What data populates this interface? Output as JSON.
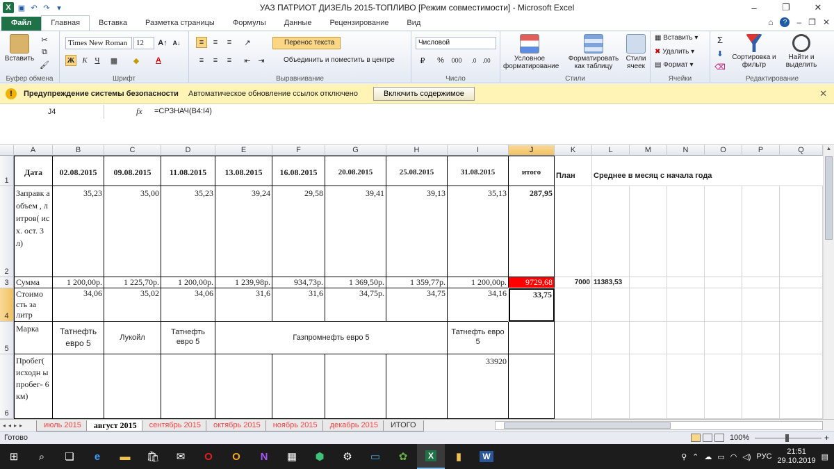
{
  "window": {
    "title": "УАЗ ПАТРИОТ ДИЗЕЛЬ 2015-ТОПЛИВО  [Режим совместимости]  -  Microsoft Excel"
  },
  "ribbon_tabs": [
    "Файл",
    "Главная",
    "Вставка",
    "Разметка страницы",
    "Формулы",
    "Данные",
    "Рецензирование",
    "Вид"
  ],
  "ribbon": {
    "paste": "Вставить",
    "clipboard_group": "Буфер обмена",
    "font_name": "Times New Roman",
    "font_size": "12",
    "font_group": "Шрифт",
    "wrap_text": "Перенос текста",
    "merge_center": "Объединить и поместить в центре",
    "align_group": "Выравнивание",
    "number_format": "Числовой",
    "number_group": "Число",
    "cond_format": "Условное форматирование",
    "format_table": "Форматировать как таблицу",
    "cell_styles": "Стили ячеек",
    "styles_group": "Стили",
    "insert": "Вставить",
    "delete": "Удалить",
    "format": "Формат",
    "cells_group": "Ячейки",
    "sort_filter": "Сортировка и фильтр",
    "find_select": "Найти и выделить",
    "editing_group": "Редактирование"
  },
  "security": {
    "title": "Предупреждение системы безопасности",
    "message": "Автоматическое обновление ссылок отключено",
    "button": "Включить содержимое"
  },
  "formula_bar": {
    "name_box": "J4",
    "fx": "fx",
    "formula": "=СРЗНАЧ(B4:I4)"
  },
  "columns": [
    "A",
    "B",
    "C",
    "D",
    "E",
    "F",
    "G",
    "H",
    "I",
    "J",
    "K",
    "L",
    "M",
    "N",
    "O",
    "P",
    "Q"
  ],
  "rows": [
    "1",
    "2",
    "3",
    "4",
    "5",
    "6"
  ],
  "sheet": {
    "header": {
      "a": "Дата",
      "dates": [
        "02.08.2015",
        "09.08.2015",
        "11.08.2015",
        "13.08.2015",
        "16.08.2015",
        "20.08.2015",
        "25.08.2015",
        "31.08.2015"
      ],
      "total": "итого",
      "plan": "План",
      "avg": "Среднее в месяц с начала года"
    },
    "fuel": {
      "label": "Заправк а объем , литров( исх. ост. 3 л)",
      "values": [
        "35,23",
        "35,00",
        "35,23",
        "39,24",
        "29,58",
        "39,41",
        "39,13",
        "35,13"
      ],
      "total": "287,95"
    },
    "sum": {
      "label": "Сумма",
      "values": [
        "1 200,00р.",
        "1 225,70р.",
        "1 200,00р.",
        "1 239,98р.",
        "934,73р.",
        "1 369,50р.",
        "1 359,77р.",
        "1 200,00р."
      ],
      "total": "9729,68",
      "plan": "7000",
      "avg": "11383,53"
    },
    "price": {
      "label": "Стоимо сть за литр",
      "values": [
        "34,06",
        "35,02",
        "34,06",
        "31,6",
        "31,6",
        "34,75р.",
        "34,75",
        "34,16"
      ],
      "total": "33,75"
    },
    "brand": {
      "label": "Марка",
      "b": "Татнефть евро 5",
      "c": "Лукойл",
      "d": "Татнефть евро 5",
      "efgh": "Газпромнефть евро 5",
      "i": "Татнефть евро 5"
    },
    "mileage": {
      "label": "Пробег( исходн ы пробег- 6 км)",
      "i": "33920"
    }
  },
  "sheet_tabs": [
    "июль 2015",
    "август 2015",
    "сентябрь 2015",
    "октябрь 2015",
    "ноябрь 2015",
    "декабрь 2015",
    "ИТОГО"
  ],
  "status": {
    "ready": "Готово",
    "zoom": "100%"
  },
  "taskbar": {
    "lang": "РУС",
    "time": "21:51",
    "date": "29.10.2019"
  },
  "colors": {
    "excel_green": "#1f7245",
    "warning_bar": "#fff3b5",
    "highlight_red": "#ff0000"
  }
}
